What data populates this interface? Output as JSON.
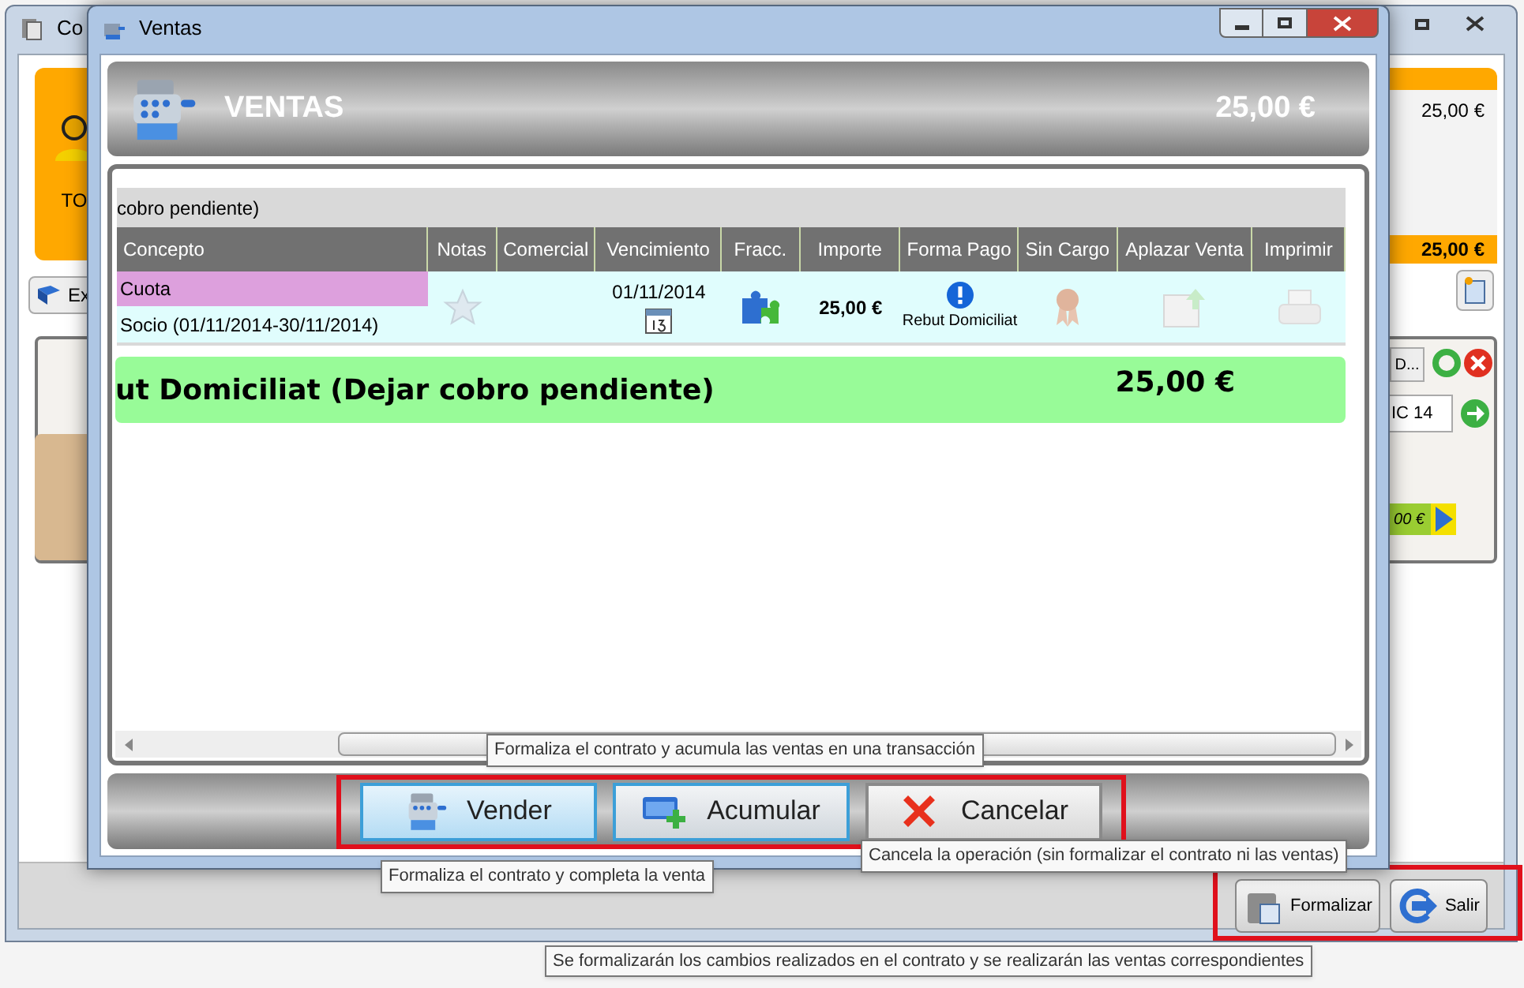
{
  "background_window": {
    "title": "Co",
    "panel_label": "TO",
    "export_button": "Ex",
    "summary_amount": "25,00 €",
    "summary_total": "25,00 €",
    "button_fragment": "D...",
    "field_fragment": "IC 14",
    "amount_fragment": "00 €",
    "buttons": [
      {
        "label": "Formalizar",
        "kind": "formalize"
      },
      {
        "label": "Salir",
        "kind": "exit"
      }
    ],
    "tooltip": "Se formalizarán los cambios realizados en el contrato y se realizarán las ventas correspondientes"
  },
  "dialog": {
    "title": "Ventas",
    "header": {
      "title": "VENTAS",
      "total": "25,00 €"
    },
    "group_caption": "cobro pendiente)",
    "table": {
      "columns": [
        "Concepto",
        "Notas",
        "Comercial",
        "Vencimiento",
        "Fracc.",
        "Importe",
        "Forma Pago",
        "Sin Cargo",
        "Aplazar Venta",
        "Imprimir"
      ],
      "rows": [
        {
          "concept": "Cuota",
          "detail": "Socio (01/11/2014-30/11/2014)",
          "due_date": "01/11/2014",
          "amount": "25,00 €",
          "payment": "Rebut Domiciliat"
        }
      ]
    },
    "summary": {
      "label": "ut Domiciliat (Dejar cobro pendiente)",
      "amount": "25,00 €"
    },
    "buttons": [
      {
        "label": "Vender",
        "kind": "sell",
        "highlighted": true
      },
      {
        "label": "Acumular",
        "kind": "accumulate",
        "highlighted": false
      },
      {
        "label": "Cancelar",
        "kind": "cancel",
        "highlighted": false
      }
    ],
    "tooltips": [
      {
        "text": "Formaliza el contrato y acumula las ventas en una transacción",
        "kind": "accumulate"
      },
      {
        "text": "Formaliza el contrato y completa la venta",
        "kind": "sell"
      },
      {
        "text": "Cancela la operación (sin formalizar el contrato ni las ventas)",
        "kind": "cancel"
      }
    ]
  }
}
